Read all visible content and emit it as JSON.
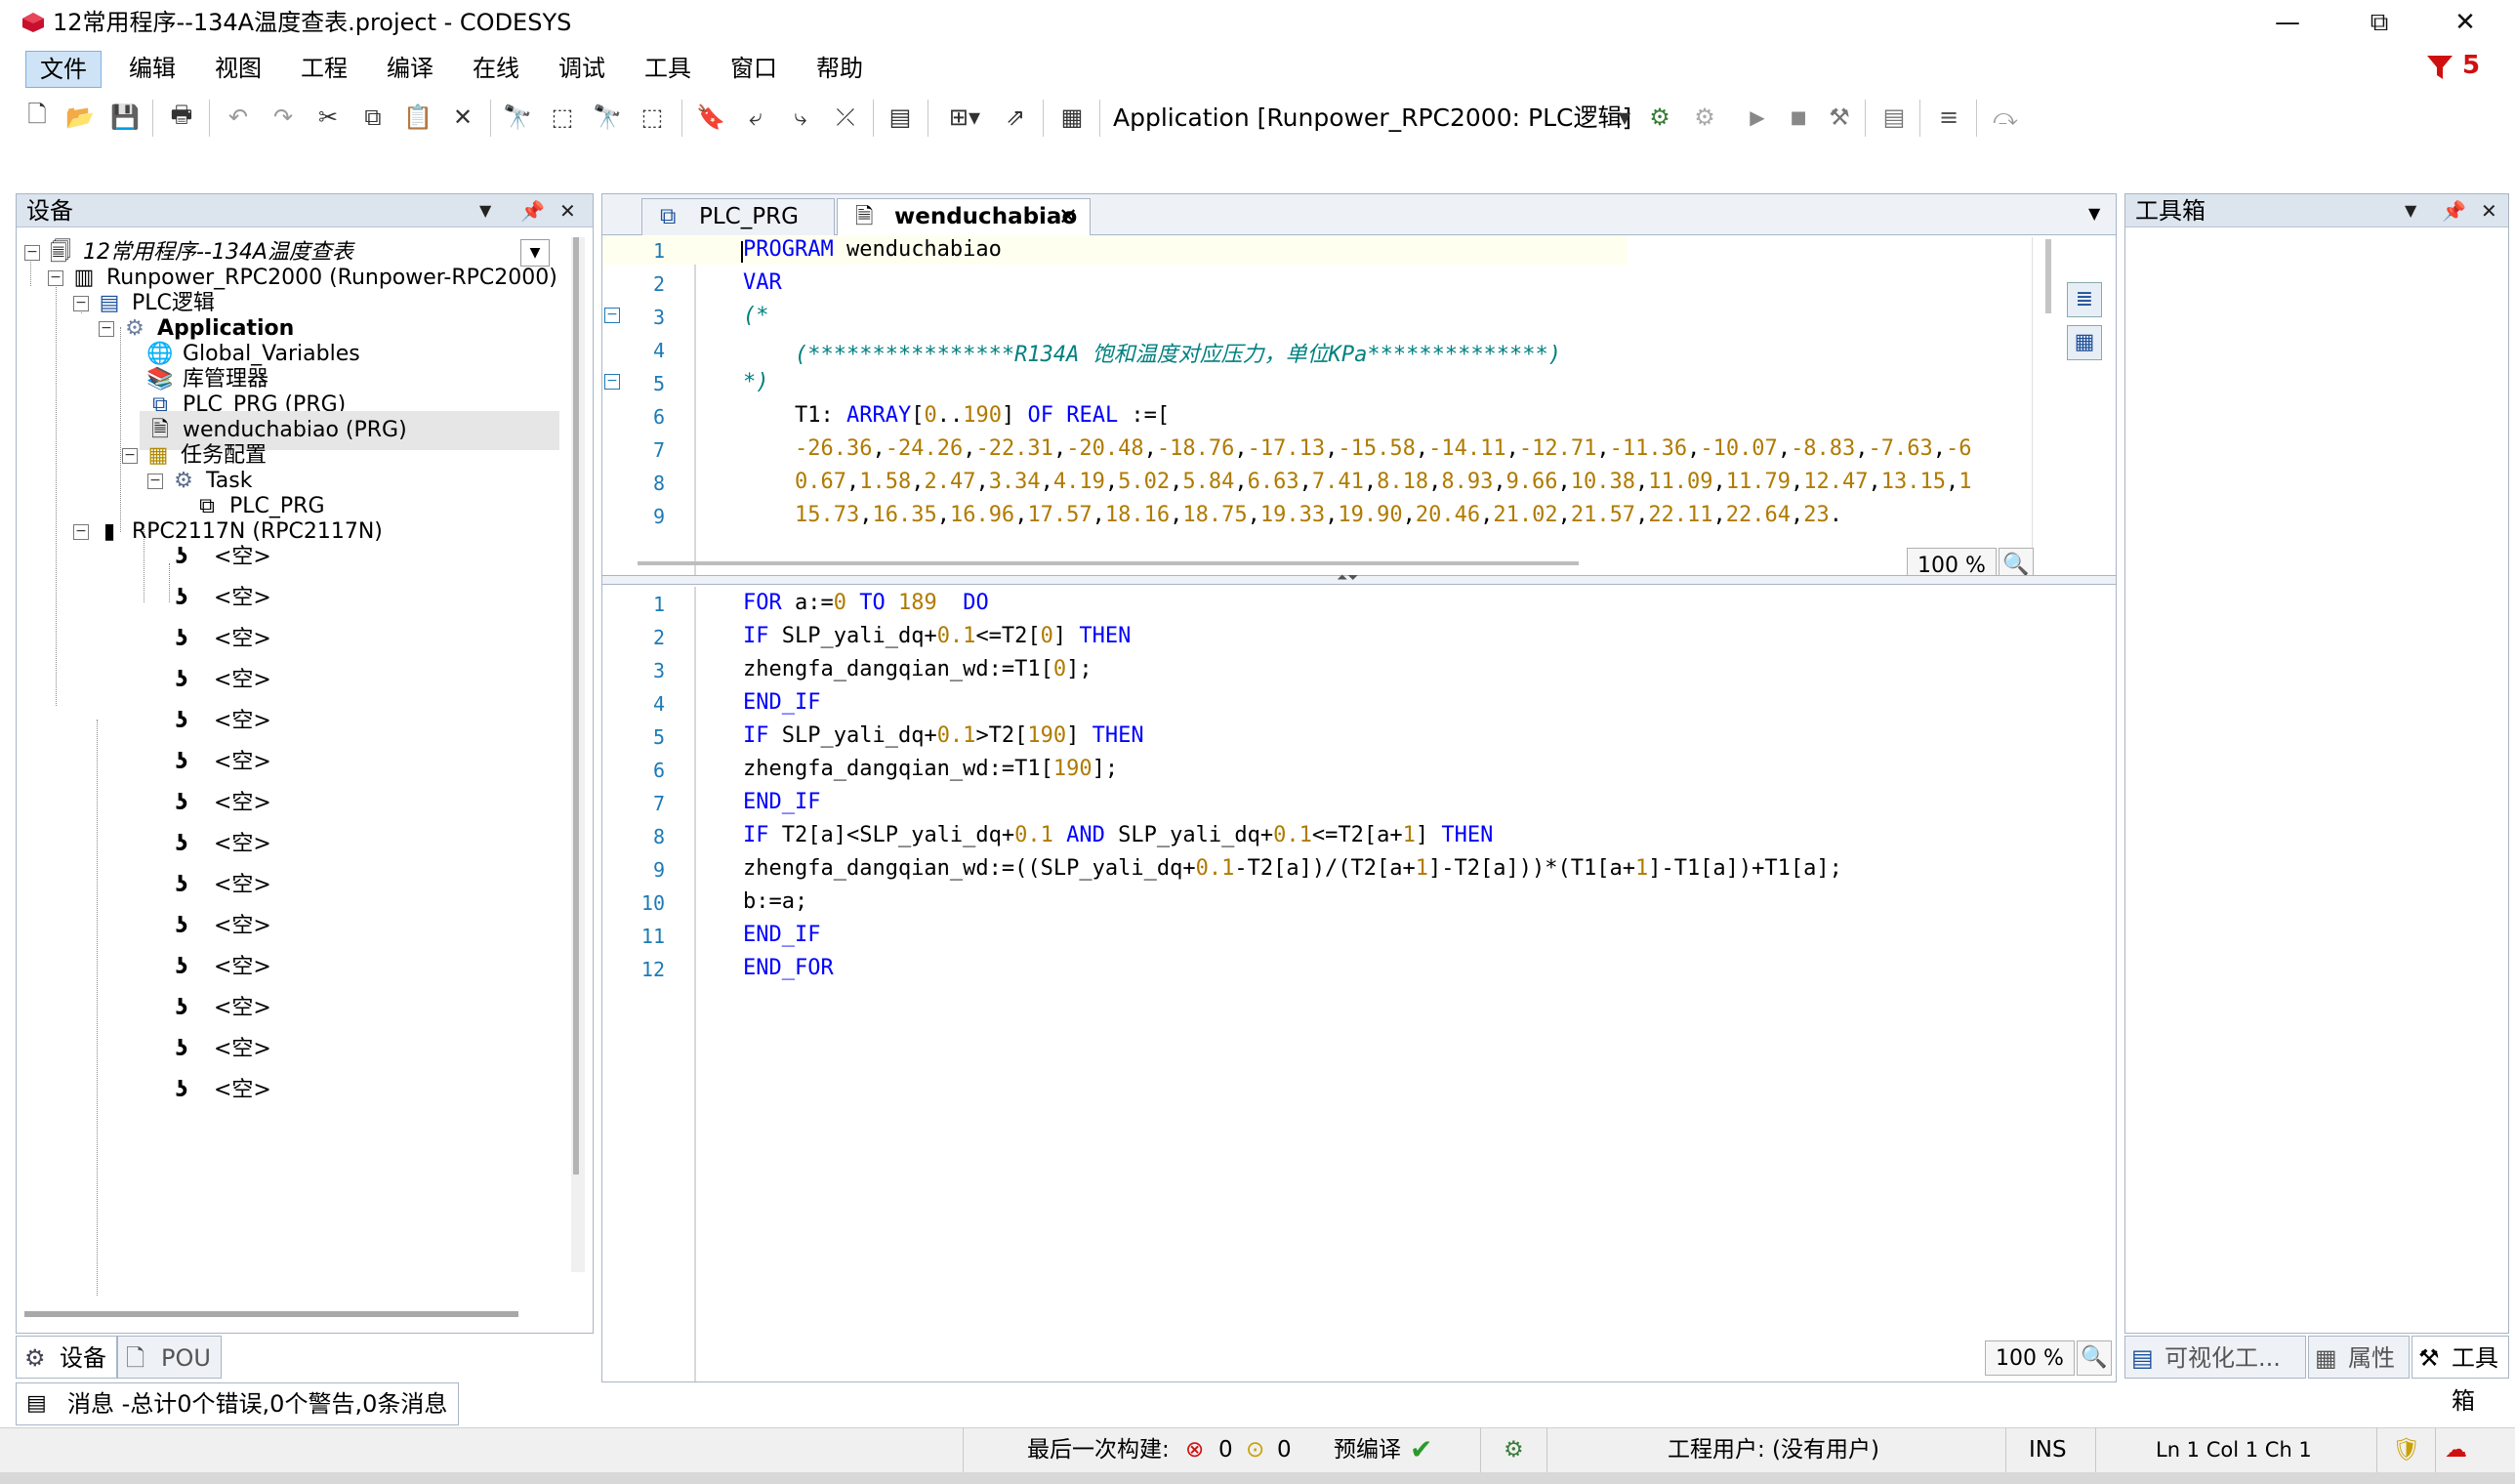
{
  "window": {
    "title": "12常用程序--134A温度查表.project - CODESYS",
    "minimize": "—",
    "maximize": "⧉",
    "close": "✕"
  },
  "menu": {
    "items": [
      "文件",
      "编辑",
      "视图",
      "工程",
      "编译",
      "在线",
      "调试",
      "工具",
      "窗口",
      "帮助"
    ],
    "badge": "5"
  },
  "toolbar": {
    "application": "Application [Runpower_RPC2000: PLC逻辑]"
  },
  "devices": {
    "header": "设备",
    "tree": [
      {
        "label": "12常用程序--134A温度查表",
        "icon": "project-icon"
      },
      {
        "label": "Runpower_RPC2000 (Runpower-RPC2000)",
        "icon": "device-icon"
      },
      {
        "label": "PLC逻辑",
        "icon": "plc-logic-icon"
      },
      {
        "label": "Application",
        "icon": "gear-icon"
      },
      {
        "label": "Global_Variables",
        "icon": "globe-icon"
      },
      {
        "label": "库管理器",
        "icon": "library-icon"
      },
      {
        "label": "PLC_PRG (PRG)",
        "icon": "program-icon"
      },
      {
        "label": "wenduchabiao (PRG)",
        "icon": "document-icon"
      },
      {
        "label": "任务配置",
        "icon": "task-config-icon"
      },
      {
        "label": "Task",
        "icon": "task-icon"
      },
      {
        "label": "PLC_PRG",
        "icon": "program-icon"
      },
      {
        "label": "RPC2117N (RPC2117N)",
        "icon": "module-icon"
      }
    ],
    "empty_slot": "<空>",
    "tabs": [
      "设备",
      "POU"
    ]
  },
  "editor": {
    "tabs": [
      "PLC_PRG",
      "wenduchabiao"
    ],
    "top_zoom": "100 %",
    "bottom_zoom": "100 %",
    "decl_lines": [
      "PROGRAM wenduchabiao",
      "VAR",
      "(*",
      "    (****************R134A 饱和温度对应压力，单位KPa**************)",
      "*)",
      "    T1: ARRAY[0..190] OF REAL :=[",
      "    -26.36,-24.26,-22.31,-20.48,-18.76,-17.13,-15.58,-14.11,-12.71,-11.36,-10.07,-8.83,-7.63,-6",
      "    0.67,1.58,2.47,3.34,4.19,5.02,5.84,6.63,7.41,8.18,8.93,9.66,10.38,11.09,11.79,12.47,13.15,1",
      "    15.73,16.35,16.96,17.57,18.16,18.75,19.33,19.90,20.46,21.02,21.57,22.11,22.64,23."
    ],
    "impl_lines": [
      "FOR a:=0 TO 189  DO",
      "IF SLP_yali_dq+0.1<=T2[0] THEN",
      "zhengfa_dangqian_wd:=T1[0];",
      "END_IF",
      "IF SLP_yali_dq+0.1>T2[190] THEN",
      "zhengfa_dangqian_wd:=T1[190];",
      "END_IF",
      "IF T2[a]<SLP_yali_dq+0.1 AND SLP_yali_dq+0.1<=T2[a+1] THEN",
      "zhengfa_dangqian_wd:=((SLP_yali_dq+0.1-T2[a])/(T2[a+1]-T2[a]))*(T1[a+1]-T1[a])+T1[a];",
      "b:=a;",
      "END_IF",
      "END_FOR"
    ]
  },
  "toolbox": {
    "header": "工具箱",
    "tabs": [
      "可视化工...",
      "属性",
      "工具箱"
    ]
  },
  "messages": {
    "label": "消息 -总计0个错误,0个警告,0条消息"
  },
  "status": {
    "last_build": "最后一次构建:",
    "errors": "0",
    "warnings": "0",
    "precompile": "预编译",
    "user": "工程用户: (没有用户)",
    "ins": "INS",
    "position": "Ln 1  Col 1  Ch 1"
  }
}
